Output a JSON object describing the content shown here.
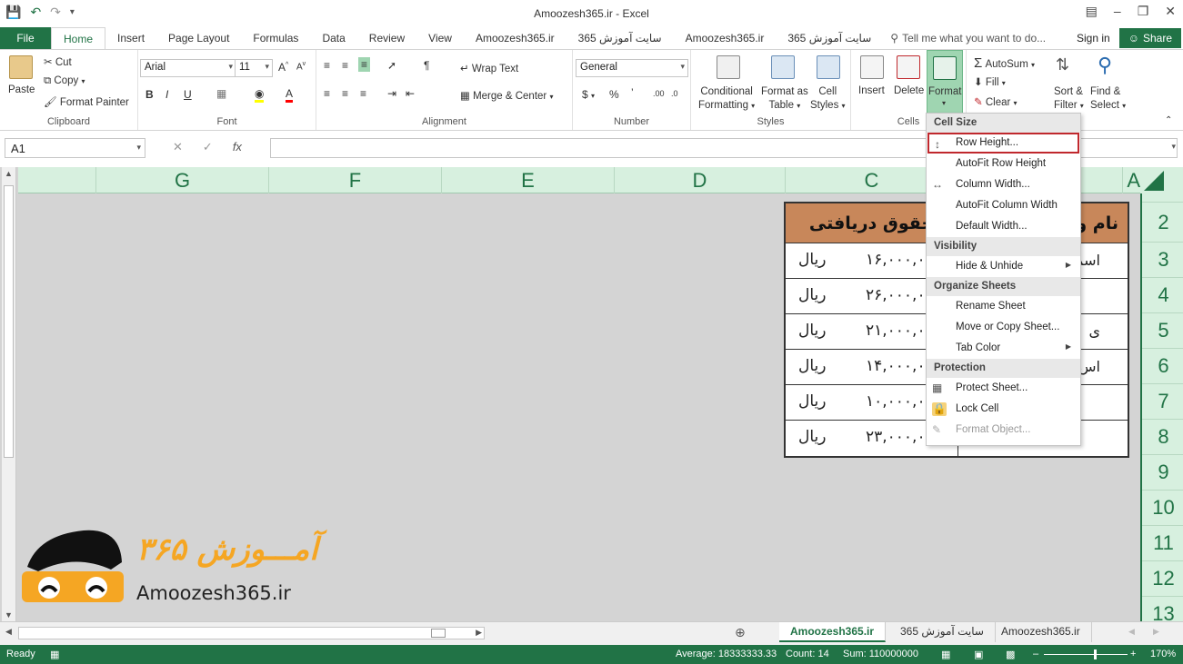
{
  "window": {
    "title": "Amoozesh365.ir - Excel"
  },
  "tabs": {
    "file": "File",
    "items": [
      "Home",
      "Insert",
      "Page Layout",
      "Formulas",
      "Data",
      "Review",
      "View",
      "Amoozesh365.ir",
      "سایت آموزش 365",
      "Amoozesh365.ir",
      "سایت آموزش 365"
    ],
    "tell_me": "Tell me what you want to do...",
    "sign_in": "Sign in",
    "share": "Share"
  },
  "ribbon": {
    "clipboard": {
      "paste": "Paste",
      "cut": "Cut",
      "copy": "Copy",
      "format_painter": "Format Painter",
      "label": "Clipboard"
    },
    "font": {
      "name": "Arial",
      "size": "11",
      "label": "Font"
    },
    "alignment": {
      "wrap_text": "Wrap Text",
      "merge_center": "Merge & Center",
      "label": "Alignment"
    },
    "number": {
      "format": "General",
      "label": "Number"
    },
    "styles": {
      "conditional_1": "Conditional",
      "conditional_2": "Formatting",
      "format_as_1": "Format as",
      "format_as_2": "Table",
      "cell_1": "Cell",
      "cell_2": "Styles",
      "label": "Styles"
    },
    "cells": {
      "insert": "Insert",
      "delete": "Delete",
      "format": "Format",
      "label": "Cells"
    },
    "editing": {
      "autosum": "AutoSum",
      "fill": "Fill",
      "clear": "Clear",
      "sort_1": "Sort &",
      "sort_2": "Filter",
      "find_1": "Find &",
      "find_2": "Select"
    }
  },
  "formula_bar": {
    "name_box": "A1",
    "fx": "fx"
  },
  "grid": {
    "columns": [
      "G",
      "F",
      "E",
      "D",
      "C",
      "A"
    ],
    "rows": [
      "2",
      "3",
      "4",
      "5",
      "6",
      "7",
      "8",
      "9",
      "10",
      "11",
      "12",
      "13"
    ]
  },
  "table": {
    "header_c": "حقوق دریافتی",
    "header_b": "نام و",
    "rows": [
      {
        "amount": "۱۶,۰۰۰,۰",
        "unit": "ریال",
        "name": "اسم"
      },
      {
        "amount": "۲۶,۰۰۰,۰",
        "unit": "ریال",
        "name": ""
      },
      {
        "amount": "۲۱,۰۰۰,۰",
        "unit": "ریال",
        "name": "ی"
      },
      {
        "amount": "۱۴,۰۰۰,۰",
        "unit": "ریال",
        "name": "اس"
      },
      {
        "amount": "۱۰,۰۰۰,۰",
        "unit": "ریال",
        "name": ""
      },
      {
        "amount": "۲۳,۰۰۰,۰",
        "unit": "ریال",
        "name": ""
      }
    ]
  },
  "logo": {
    "persian": "آمـــوزش ۳۶۵",
    "latin": "Amoozesh365.ir"
  },
  "menu": {
    "cell_size": "Cell Size",
    "row_height": "Row Height...",
    "autofit_row": "AutoFit Row Height",
    "column_width": "Column Width...",
    "autofit_column": "AutoFit Column Width",
    "default_width": "Default Width...",
    "visibility": "Visibility",
    "hide_unhide": "Hide & Unhide",
    "organize": "Organize Sheets",
    "rename": "Rename Sheet",
    "move_copy": "Move or Copy Sheet...",
    "tab_color": "Tab Color",
    "protection": "Protection",
    "protect_sheet": "Protect Sheet...",
    "lock_cell": "Lock Cell",
    "format_object": "Format Object..."
  },
  "sheets": {
    "active": "Amoozesh365.ir",
    "second": "سایت آموزش 365",
    "third": "Amoozesh365.ir"
  },
  "status": {
    "ready": "Ready",
    "average": "Average: 18333333.33",
    "count": "Count: 14",
    "sum": "Sum: 110000000",
    "zoom": "170%"
  },
  "colors": {
    "accent": "#217346",
    "table_header": "#c8875a",
    "highlight": "#c0282d",
    "logo_orange": "#f5a623"
  }
}
